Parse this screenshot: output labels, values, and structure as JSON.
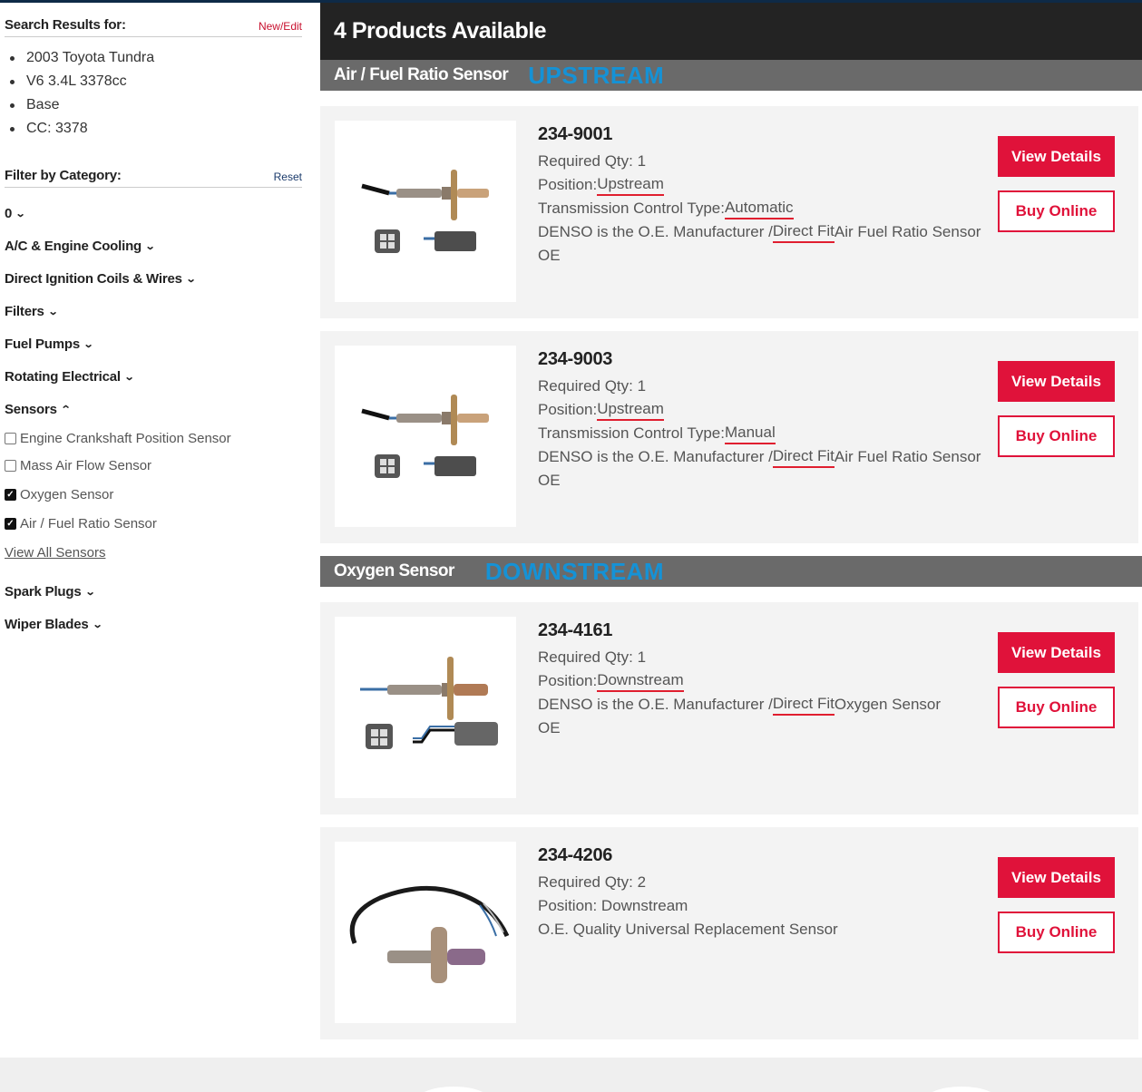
{
  "sidebar": {
    "search_title": "Search Results for:",
    "new_edit": "New/Edit",
    "vehicle": [
      "2003 Toyota Tundra",
      "V6 3.4L 3378cc",
      "Base",
      "CC: 3378"
    ],
    "filter_title": "Filter by Category:",
    "reset": "Reset",
    "categories_top": [
      {
        "label": "0",
        "expanded": false
      },
      {
        "label": "A/C & Engine Cooling",
        "expanded": false
      },
      {
        "label": "Direct Ignition Coils & Wires",
        "expanded": false
      },
      {
        "label": "Filters",
        "expanded": false
      },
      {
        "label": "Fuel Pumps",
        "expanded": false
      },
      {
        "label": "Rotating Electrical",
        "expanded": false
      },
      {
        "label": "Sensors",
        "expanded": true
      }
    ],
    "sensor_options": [
      {
        "label": "Engine Crankshaft Position Sensor",
        "checked": false
      },
      {
        "label": "Mass Air Flow Sensor",
        "checked": false
      },
      {
        "label": "Oxygen Sensor",
        "checked": true
      },
      {
        "label": "Air / Fuel Ratio Sensor",
        "checked": true
      }
    ],
    "view_all": "View All Sensors",
    "categories_bottom": [
      {
        "label": "Spark Plugs",
        "expanded": false
      },
      {
        "label": "Wiper Blades",
        "expanded": false
      }
    ]
  },
  "main": {
    "banner": "4 Products Available",
    "sections": [
      {
        "title": "Air / Fuel Ratio Sensor",
        "tag": "UPSTREAM"
      },
      {
        "title": "Oxygen Sensor",
        "tag": "DOWNSTREAM"
      }
    ],
    "products": [
      {
        "part": "234-9001",
        "qty_label": "Required Qty: 1",
        "pos_prefix": "Position: ",
        "pos_value": "Upstream",
        "trans_prefix": "Transmission Control Type: ",
        "trans_value": "Automatic",
        "desc_a": "DENSO is the O.E. Manufacturer / ",
        "desc_b": "Direct Fit",
        "desc_c": " Air Fuel Ratio Sensor",
        "oe": "OE"
      },
      {
        "part": "234-9003",
        "qty_label": "Required Qty: 1",
        "pos_prefix": "Position: ",
        "pos_value": "Upstream",
        "trans_prefix": "Transmission Control Type: ",
        "trans_value": "Manual",
        "desc_a": "DENSO is the O.E. Manufacturer / ",
        "desc_b": "Direct Fit",
        "desc_c": " Air Fuel Ratio Sensor",
        "oe": "OE"
      },
      {
        "part": "234-4161",
        "qty_label": "Required Qty: 1",
        "pos_prefix": "Position: ",
        "pos_value": "Downstream",
        "desc_a": "DENSO is the O.E. Manufacturer / ",
        "desc_b": "Direct Fit",
        "desc_c": " Oxygen Sensor",
        "oe": "OE"
      },
      {
        "part": "234-4206",
        "qty_label": "Required Qty: 2",
        "pos_line": "Position: Downstream",
        "desc_line": "O.E. Quality Universal Replacement Sensor"
      }
    ],
    "view_details": "View Details",
    "buy_online": "Buy Online"
  }
}
